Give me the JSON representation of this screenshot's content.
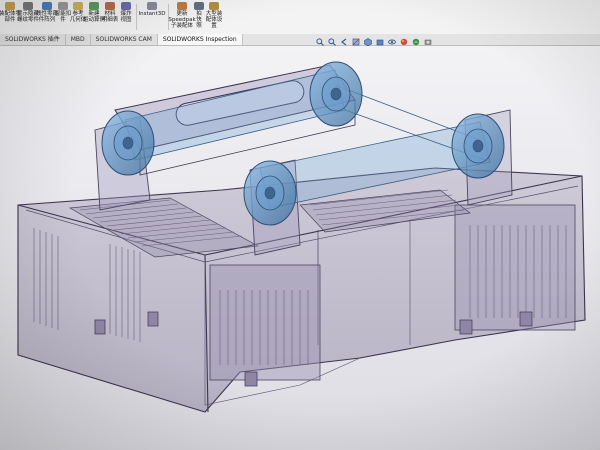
{
  "ribbon": {
    "buttons": [
      {
        "label": "装配体零\n部件",
        "icon": "assembly-icon"
      },
      {
        "label": "显示隐藏\n螺纹零件",
        "icon": "hide-show-icon"
      },
      {
        "label": "线性零部\n件阵列",
        "icon": "pattern-icon"
      },
      {
        "label": "智能扣\n件",
        "icon": "fastener-icon"
      },
      {
        "label": "参考\n几何体",
        "icon": "reference-geometry-icon"
      },
      {
        "label": "新建\n运动算例",
        "icon": "motion-study-icon"
      },
      {
        "label": "材料\n明细表",
        "icon": "bom-icon"
      },
      {
        "label": "爆炸\n视图",
        "icon": "exploded-view-icon"
      },
      {
        "label": "Instant3D",
        "icon": "instant3d-icon"
      },
      {
        "label": "更新\nSpeedpak\n子装配体",
        "icon": "speedpak-icon"
      },
      {
        "label": "拍\n快\n照",
        "icon": "snapshot-icon"
      },
      {
        "label": "大型装\n配体设\n置",
        "icon": "large-assembly-icon"
      }
    ]
  },
  "tabs": [
    "SOLIDWORKS 插件",
    "MBD",
    "SOLIDWORKS CAM",
    "SOLIDWORKS Inspection"
  ],
  "active_tab": 3,
  "hud_icons": [
    "zoom-to-fit-icon",
    "zoom-area-icon",
    "previous-view-icon",
    "section-view-icon",
    "view-orientation-icon",
    "display-style-icon",
    "hide-show-items-icon",
    "edit-appearance-icon",
    "apply-scene-icon",
    "view-settings-icon"
  ],
  "colors": {
    "model_fill": "#a79fb8",
    "model_edge": "#3d3550",
    "pulley": "#5b92c8",
    "background_top": "#f6f6f8",
    "background_bottom": "#dedde3"
  }
}
